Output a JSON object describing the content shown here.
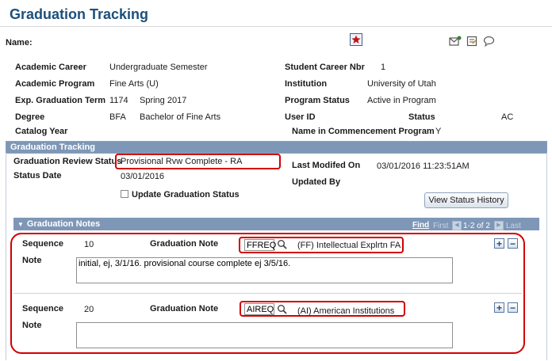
{
  "page": {
    "title": "Graduation Tracking",
    "name_label": "Name:"
  },
  "header_icons": [
    "star-icon",
    "notify-icon",
    "new-window-icon",
    "help-icon"
  ],
  "student": {
    "academic_career_label": "Academic Career",
    "academic_career": "Undergraduate Semester",
    "academic_program_label": "Academic Program",
    "academic_program": "Fine Arts (U)",
    "exp_grad_term_label": "Exp. Graduation Term",
    "exp_grad_term_code": "1174",
    "exp_grad_term_desc": "Spring 2017",
    "degree_label": "Degree",
    "degree_code": "BFA",
    "degree_desc": "Bachelor of Fine Arts",
    "catalog_year_label": "Catalog Year",
    "student_career_nbr_label": "Student Career Nbr",
    "student_career_nbr": "1",
    "institution_label": "Institution",
    "institution": "University of Utah",
    "program_status_label": "Program Status",
    "program_status": "Active in Program",
    "user_id_label": "User ID",
    "status_label": "Status",
    "status": "AC",
    "commencement_label": "Name in Commencement Program",
    "commencement": "Y"
  },
  "tracking": {
    "header": "Graduation Tracking",
    "review_status_label": "Graduation Review Status",
    "review_status": "Provisional Rvw Complete - RA",
    "status_date_label": "Status Date",
    "status_date": "03/01/2016",
    "last_modified_label": "Last Modifed On",
    "last_modified": "03/01/2016 11:23:51AM",
    "updated_by_label": "Updated By",
    "update_checkbox_label": "Update Graduation Status",
    "view_history_button": "View Status History"
  },
  "notes": {
    "header": "Graduation Notes",
    "nav": {
      "find": "Find",
      "first": "First",
      "range": "1-2 of 2",
      "last": "Last"
    },
    "sequence_label": "Sequence",
    "grad_note_label": "Graduation Note",
    "note_label": "Note",
    "rows": [
      {
        "sequence": "10",
        "code": "FFREQ",
        "desc": "(FF) Intellectual Explrtn FA",
        "note": "initial, ej, 3/1/16. provisional course complete ej 3/5/16."
      },
      {
        "sequence": "20",
        "code": "AIREQ",
        "desc": "(AI) American Institutions",
        "note": ""
      }
    ]
  },
  "colors": {
    "title": "#1c4f7c",
    "panel_header": "#7e97b7",
    "highlight": "#d20000"
  }
}
